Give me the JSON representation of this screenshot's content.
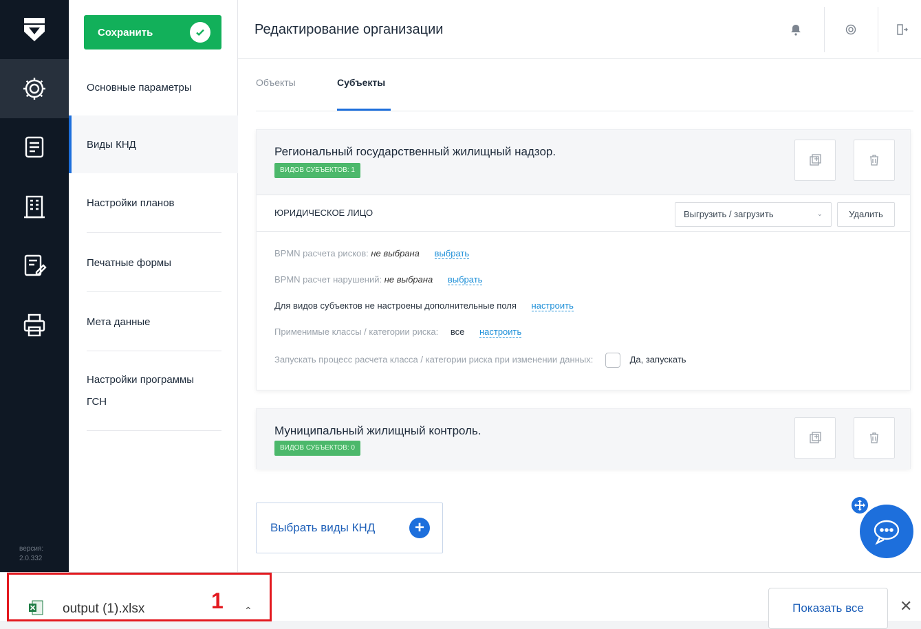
{
  "sidebar": {
    "version_label": "версия:",
    "version_value": "2.0.332",
    "icons": [
      "logo-icon",
      "gear-icon",
      "document-list-icon",
      "building-icon",
      "form-edit-icon",
      "printer-icon"
    ]
  },
  "toolbar": {
    "save_label": "Сохранить"
  },
  "menu": {
    "items": [
      {
        "label": "Основные параметры"
      },
      {
        "label": "Виды КНД"
      },
      {
        "label": "Настройки планов"
      },
      {
        "label": "Печатные формы"
      },
      {
        "label": "Мета данные"
      },
      {
        "label": "Настройки программы ГСН"
      }
    ],
    "selected": "Виды КНД"
  },
  "header": {
    "title": "Редактирование организации"
  },
  "tabs": [
    {
      "label": "Объекты",
      "active": false
    },
    {
      "label": "Субъекты",
      "active": true
    }
  ],
  "cards": [
    {
      "title": "Региональный государственный жилищный надзор.",
      "badge": "видов субъектов: 1",
      "entity": {
        "label": "юридическое лицо",
        "export_label": "Выгрузить / загрузить",
        "delete_label": "Удалить"
      },
      "settings": {
        "bpmn_risk_label": "BPMN расчета рисков:",
        "bpmn_risk_value": "не выбрана",
        "bpmn_risk_link": "выбрать",
        "bpmn_viol_label": "BPMN расчет нарушений:",
        "bpmn_viol_value": "не выбрана",
        "bpmn_viol_link": "выбрать",
        "fields_text": "Для видов субъектов не настроены дополнительные поля",
        "fields_link": "настроить",
        "classes_label": "Применимые классы / категории риска:",
        "classes_value": "все",
        "classes_link": "настроить",
        "process_label": "Запускать процесс расчета класса / категории риска при изменении данных:",
        "process_checkbox_label": "Да, запускать"
      }
    },
    {
      "title": "Муниципальный жилищный контроль.",
      "badge": "видов субъектов: 0"
    }
  ],
  "choose_button": {
    "label": "Выбрать виды КНД"
  },
  "download_bar": {
    "file_name": "output (1).xlsx",
    "marker": "1",
    "show_all": "Показать все"
  },
  "colors": {
    "rail": "#0f1824",
    "save_green": "#12b05a",
    "accent_blue": "#1d6fdc",
    "badge_green": "#4cb86b",
    "highlight_red": "#e3191f"
  }
}
